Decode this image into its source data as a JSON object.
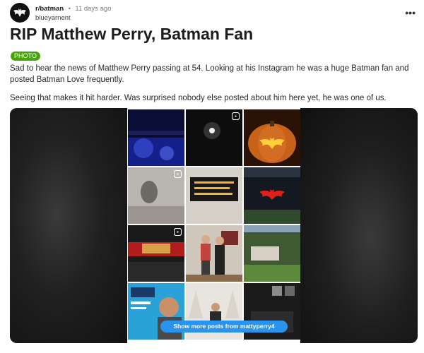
{
  "post": {
    "subreddit": "r/batman",
    "separator": "•",
    "time": "11 days ago",
    "username": "blueyarnent",
    "more_label": "•••",
    "title": "RIP Matthew Perry, Batman Fan",
    "flair": "PHOTO",
    "paragraphs": [
      "Sad to hear the news of Matthew Perry passing at 54. Looking at his Instagram he was a huge Batman fan and posted Batman Love frequently.",
      "Seeing that makes it hit harder. Was surprised nobody else posted about him here yet, he was one of us."
    ]
  },
  "embed": {
    "show_more_label": "Show more posts from mattyperry4",
    "tiles": [
      {
        "desc": "blue-night-scene",
        "reel": false
      },
      {
        "desc": "dark-light-orb",
        "reel": true
      },
      {
        "desc": "batman-pumpkin",
        "reel": false
      },
      {
        "desc": "shadow-wall",
        "reel": true
      },
      {
        "desc": "led-sign",
        "reel": false
      },
      {
        "desc": "bat-signal-night",
        "reel": false
      },
      {
        "desc": "home-theater",
        "reel": true
      },
      {
        "desc": "two-men-photo",
        "reel": false
      },
      {
        "desc": "garden-house",
        "reel": false
      },
      {
        "desc": "book-cover-portrait",
        "reel": false
      },
      {
        "desc": "christmas-trees",
        "reel": false
      },
      {
        "desc": "dark-room",
        "reel": false
      }
    ]
  },
  "colors": {
    "flair": "#46a508",
    "button": "#2a93ee",
    "text": "#1c1c1c",
    "muted": "#7c7c7c"
  }
}
